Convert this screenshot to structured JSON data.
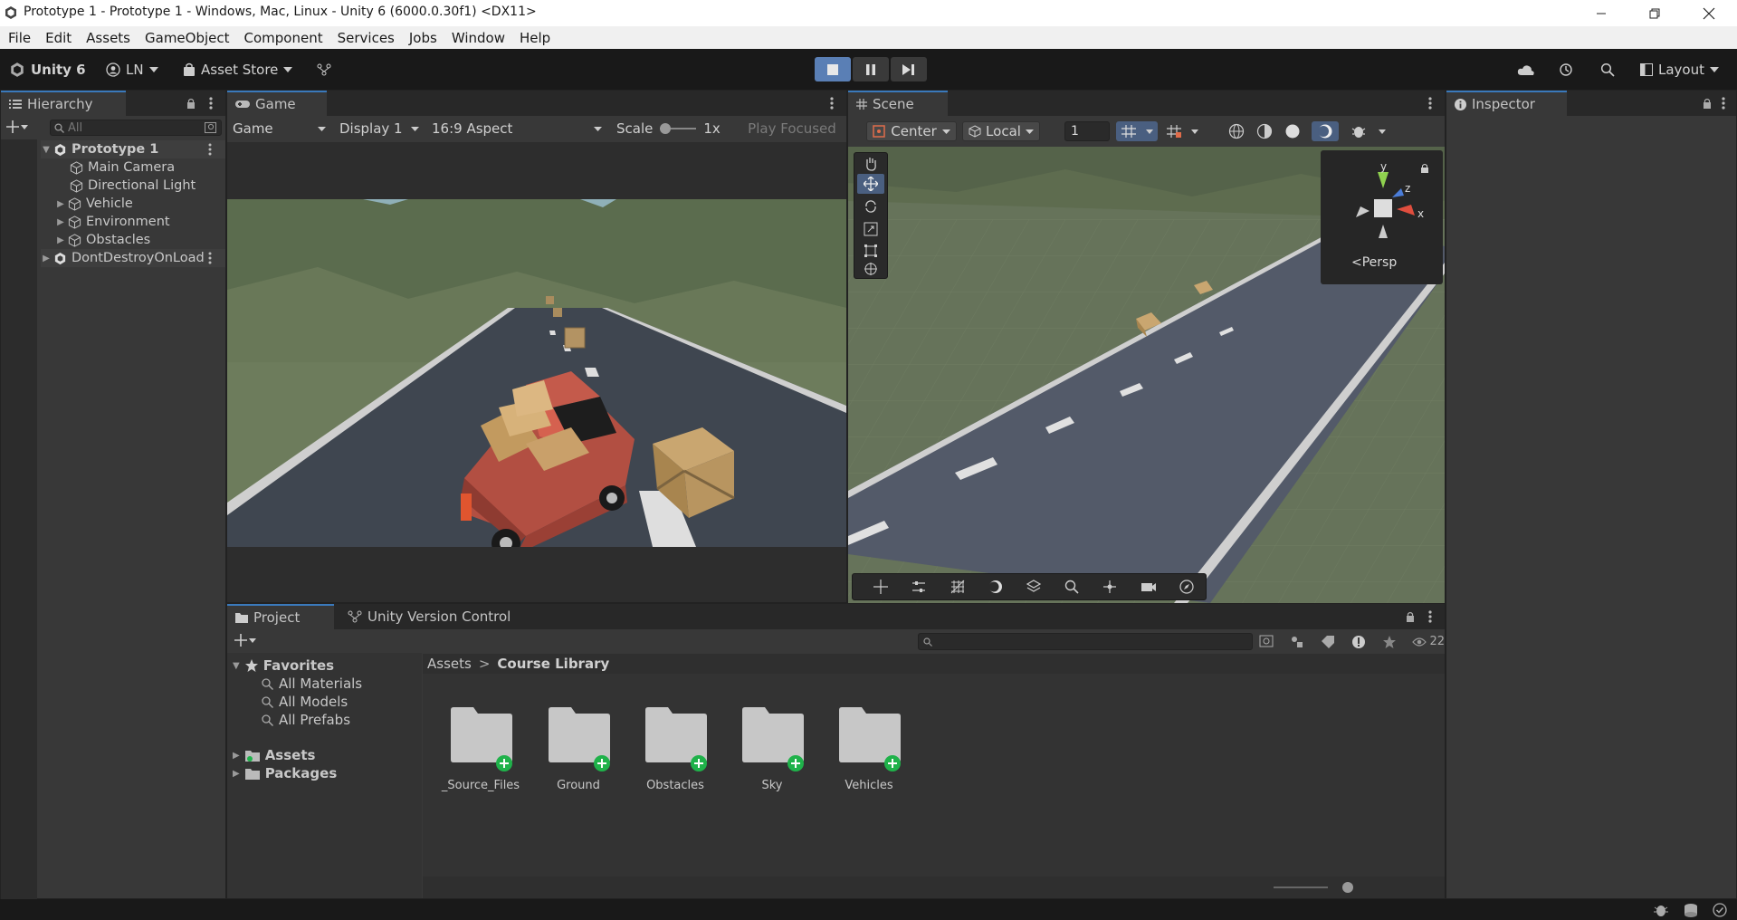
{
  "window": {
    "title": "Prototype 1 - Prototype 1 - Windows, Mac, Linux - Unity 6 (6000.0.30f1) <DX11>"
  },
  "menu": [
    "File",
    "Edit",
    "Assets",
    "GameObject",
    "Component",
    "Services",
    "Jobs",
    "Window",
    "Help"
  ],
  "toolbar": {
    "product": "Unity 6",
    "account": "LN",
    "asset_store": "Asset Store",
    "layout": "Layout"
  },
  "hierarchy": {
    "tab": "Hierarchy",
    "search_placeholder": "All",
    "scene": "Prototype 1",
    "items": [
      "Main Camera",
      "Directional Light",
      "Vehicle",
      "Environment",
      "Obstacles"
    ],
    "ddol": "DontDestroyOnLoad"
  },
  "game": {
    "tab": "Game",
    "mode": "Game",
    "display": "Display 1",
    "aspect": "16:9 Aspect",
    "scale_label": "Scale",
    "scale_value": "1x",
    "play_focused": "Play Focused"
  },
  "scene": {
    "tab": "Scene",
    "pivot": "Center",
    "space": "Local",
    "grid_snap": "1",
    "persp": "Persp",
    "axis_y": "y",
    "axis_z": "z",
    "axis_x": "x"
  },
  "inspector": {
    "tab": "Inspector"
  },
  "project": {
    "tab": "Project",
    "tab2": "Unity Version Control",
    "favorites": "Favorites",
    "fav_items": [
      "All Materials",
      "All Models",
      "All Prefabs"
    ],
    "roots": [
      "Assets",
      "Packages"
    ],
    "breadcrumb_root": "Assets",
    "breadcrumb_current": "Course Library",
    "hidden_count": "22",
    "folders": [
      "_Source_Files",
      "Ground",
      "Obstacles",
      "Sky",
      "Vehicles"
    ]
  },
  "colors": {
    "accent": "#3a79bb",
    "panel": "#383838",
    "toolbar": "#191919",
    "add_badge": "#1fb24a"
  }
}
